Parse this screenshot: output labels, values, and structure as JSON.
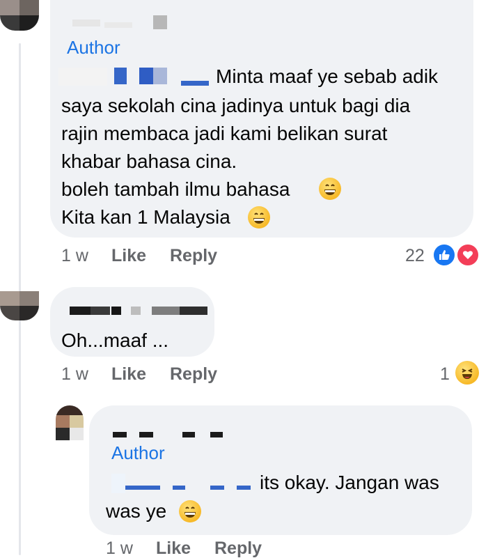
{
  "author_badge": "Author",
  "colors": {
    "bubble": "#f0f2f5",
    "author": "#1b74e4",
    "meta": "#65676b",
    "like": "#1877f2",
    "love": "#f33e58",
    "haha": "#f7b928"
  },
  "comments": [
    {
      "author_badge": "Author",
      "lines": [
        "Minta maaf ye sebab adik",
        "saya sekolah cina jadinya untuk bagi dia",
        "rajin membaca jadi kami belikan surat",
        "khabar bahasa cina.",
        "boleh tambah ilmu bahasa",
        "Kita kan 1 Malaysia"
      ],
      "emojis": [
        "grinning-face",
        "grinning-face"
      ],
      "time": "1 w",
      "like": "Like",
      "reply": "Reply",
      "reaction_count": "22",
      "reactions": [
        "like-icon",
        "love-icon"
      ]
    },
    {
      "lines": [
        "Oh...maaf ..."
      ],
      "time": "1 w",
      "like": "Like",
      "reply": "Reply",
      "reaction_count": "1",
      "reactions": [
        "laughing-icon"
      ]
    },
    {
      "author_badge": "Author",
      "lines": [
        "its okay. Jangan was",
        "was ye"
      ],
      "emojis": [
        "grinning-face"
      ],
      "time": "1 w",
      "like": "Like",
      "reply": "Reply"
    }
  ]
}
